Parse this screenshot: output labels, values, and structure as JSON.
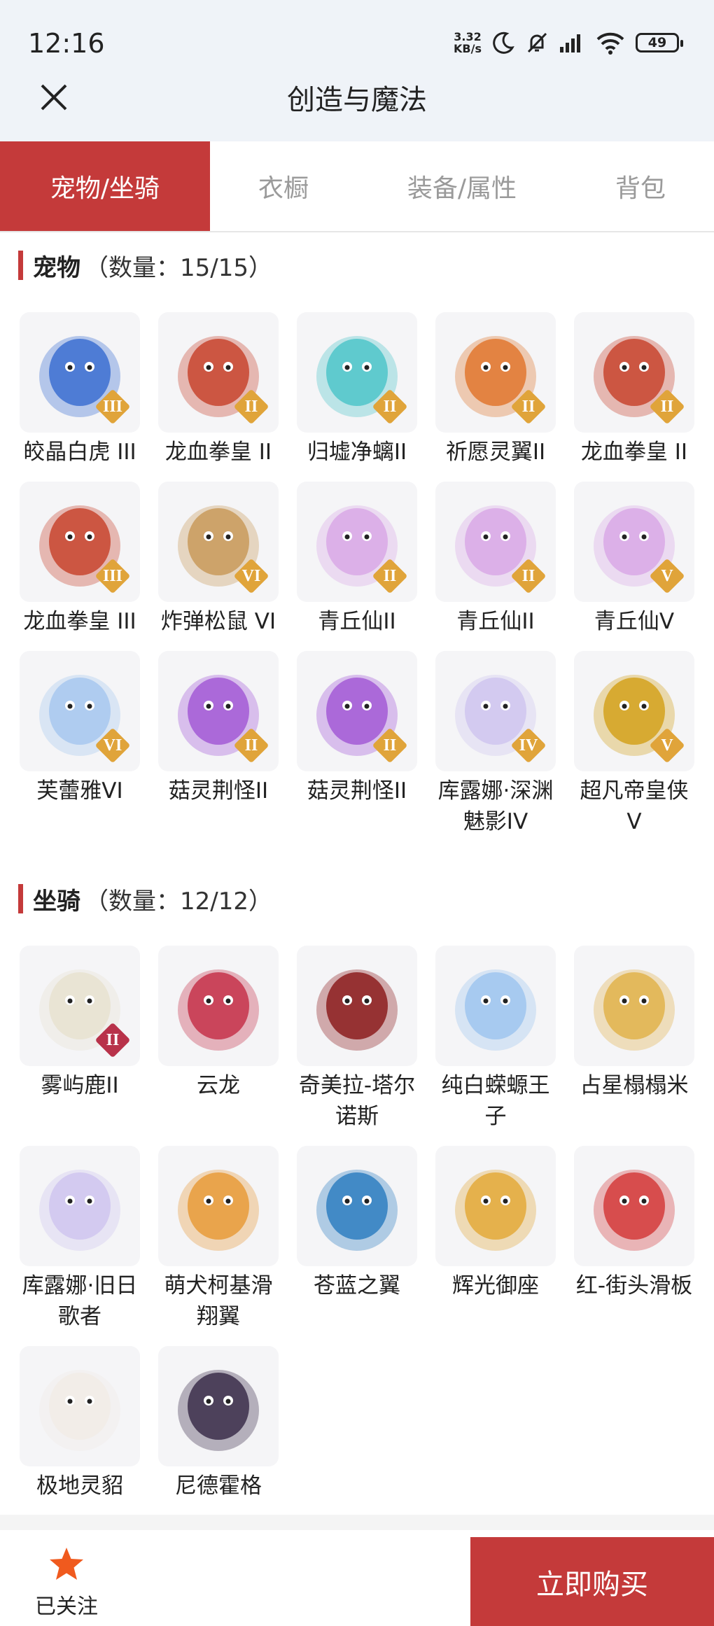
{
  "status": {
    "time": "12:16",
    "netspeed_value": "3.32",
    "netspeed_unit": "KB/s",
    "battery": "49"
  },
  "header": {
    "title": "创造与魔法"
  },
  "tabs": [
    {
      "label": "宠物/坐骑",
      "active": true
    },
    {
      "label": "衣橱",
      "active": false
    },
    {
      "label": "装备/属性",
      "active": false
    },
    {
      "label": "背包",
      "active": false
    }
  ],
  "pets": {
    "title": "宠物",
    "count": "（数量：15/15）",
    "items": [
      {
        "name": "皎晶白虎 III",
        "rank": "III",
        "icon": "white-tiger-icon",
        "color": "#3c6fd1",
        "rank_color": "#e0a43a"
      },
      {
        "name": "龙血拳皇 II",
        "rank": "II",
        "icon": "dragon-boxer-icon",
        "color": "#c8452f",
        "rank_color": "#e0a43a"
      },
      {
        "name": "归墟净螭II",
        "rank": "II",
        "icon": "jade-dragon-icon",
        "color": "#4fc6c9",
        "rank_color": "#e0a43a"
      },
      {
        "name": "祈愿灵翼II",
        "rank": "II",
        "icon": "eagle-icon",
        "color": "#e0772f",
        "rank_color": "#e0a43a"
      },
      {
        "name": "龙血拳皇 II",
        "rank": "II",
        "icon": "dragon-boxer-icon",
        "color": "#c8452f",
        "rank_color": "#e0a43a"
      },
      {
        "name": "龙血拳皇 III",
        "rank": "III",
        "icon": "dragon-boxer-icon",
        "color": "#c8452f",
        "rank_color": "#e0a43a"
      },
      {
        "name": "炸弹松鼠 VI",
        "rank": "VI",
        "icon": "squirrel-icon",
        "color": "#c99a5a",
        "rank_color": "#e0a43a"
      },
      {
        "name": "青丘仙II",
        "rank": "II",
        "icon": "fox-fairy-icon",
        "color": "#d9a8e6",
        "rank_color": "#e0a43a"
      },
      {
        "name": "青丘仙II",
        "rank": "II",
        "icon": "fox-fairy-icon",
        "color": "#d9a8e6",
        "rank_color": "#e0a43a"
      },
      {
        "name": "青丘仙V",
        "rank": "V",
        "icon": "fox-fairy-icon",
        "color": "#d9a8e6",
        "rank_color": "#e0a43a"
      },
      {
        "name": "芙蕾雅VI",
        "rank": "VI",
        "icon": "freya-icon",
        "color": "#a7c8ef",
        "rank_color": "#e0a43a"
      },
      {
        "name": "菇灵荆怪II",
        "rank": "II",
        "icon": "mushroom-elf-icon",
        "color": "#a35ad6",
        "rank_color": "#e0a43a"
      },
      {
        "name": "菇灵荆怪II",
        "rank": "II",
        "icon": "mushroom-elf-icon",
        "color": "#a35ad6",
        "rank_color": "#e0a43a"
      },
      {
        "name": "库露娜·深渊魅影IV",
        "rank": "IV",
        "icon": "kuluna-icon",
        "color": "#cfc6ee",
        "rank_color": "#e0a43a"
      },
      {
        "name": "超凡帝皇侠V",
        "rank": "V",
        "icon": "emperor-helmet-icon",
        "color": "#d4a21c",
        "rank_color": "#e0a43a"
      }
    ]
  },
  "mounts": {
    "title": "坐骑",
    "count": "（数量：12/12）",
    "items": [
      {
        "name": "雾屿鹿II",
        "rank": "II",
        "icon": "deer-icon",
        "color": "#e7e2d0",
        "rank_color": "#b8324a"
      },
      {
        "name": "云龙",
        "rank": "",
        "icon": "cloud-dragon-icon",
        "color": "#c6334a"
      },
      {
        "name": "奇美拉-塔尔诺斯",
        "rank": "",
        "icon": "chimera-icon",
        "color": "#8c1d1d"
      },
      {
        "name": "纯白蝾螈王子",
        "rank": "",
        "icon": "axolotl-icon",
        "color": "#9fc6ef"
      },
      {
        "name": "占星榻榻米",
        "rank": "",
        "icon": "tatami-icon",
        "color": "#e1b34b"
      },
      {
        "name": "库露娜·旧日歌者",
        "rank": "",
        "icon": "kuluna-singer-icon",
        "color": "#cfc6ee"
      },
      {
        "name": "萌犬柯基滑翔翼",
        "rank": "",
        "icon": "corgi-glider-icon",
        "color": "#e89b3a"
      },
      {
        "name": "苍蓝之翼",
        "rank": "",
        "icon": "blue-wing-icon",
        "color": "#2f7fc1"
      },
      {
        "name": "辉光御座",
        "rank": "",
        "icon": "throne-icon",
        "color": "#e3a93a"
      },
      {
        "name": "红-街头滑板",
        "rank": "",
        "icon": "skateboard-icon",
        "color": "#d43b3b"
      },
      {
        "name": "极地灵貂",
        "rank": "",
        "icon": "ferret-icon",
        "color": "#f1ece6"
      },
      {
        "name": "尼德霍格",
        "rank": "",
        "icon": "black-dragon-icon",
        "color": "#3b2e4a"
      }
    ]
  },
  "footer": {
    "follow_label": "已关注",
    "follow_icon": "star-icon",
    "follow_color": "#f05a1e",
    "buy_label": "立即购买"
  }
}
